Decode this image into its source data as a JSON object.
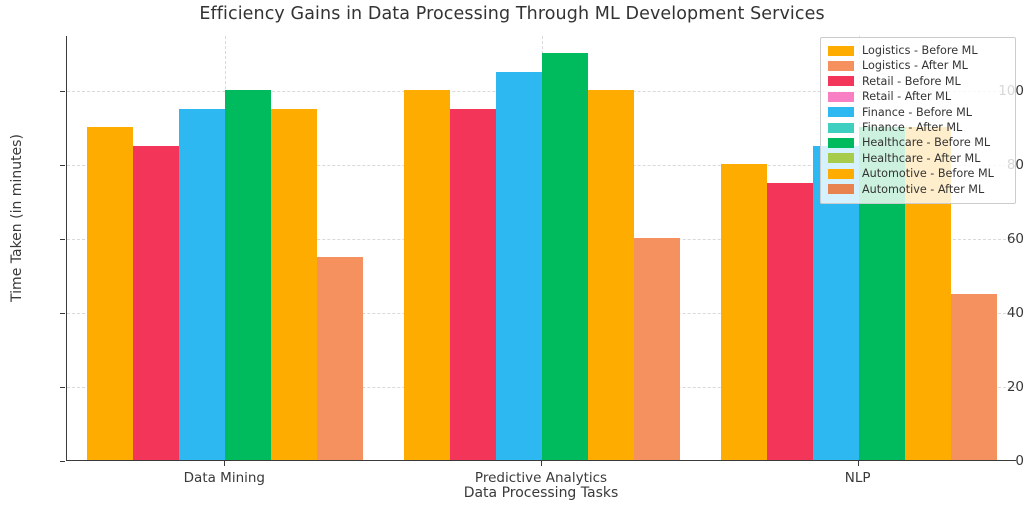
{
  "chart_data": {
    "type": "bar",
    "title": "Efficiency Gains in Data Processing Through ML Development Services",
    "xlabel": "Data Processing Tasks",
    "ylabel": "Time Taken (in minutes)",
    "categories": [
      "Data Mining",
      "Predictive Analytics",
      "NLP"
    ],
    "ylim": [
      0,
      115
    ],
    "yticks": [
      0,
      20,
      40,
      60,
      80,
      100
    ],
    "ytick_labels": [
      "0",
      "20",
      "40",
      "60",
      "80",
      "100"
    ],
    "grid": true,
    "grid_style": "dashed",
    "legend_position": "upper right",
    "bar_style": "grouped",
    "series": [
      {
        "name": "Logistics - Before ML",
        "color": "#FFAC00",
        "values": [
          90,
          100,
          80
        ]
      },
      {
        "name": "Logistics - After ML",
        "color": "#F4915E",
        "values": [
          55,
          60,
          45
        ]
      },
      {
        "name": "Retail - Before ML",
        "color": "#F23558",
        "values": [
          85,
          95,
          75
        ]
      },
      {
        "name": "Retail - After ML",
        "color": "#F97FC4",
        "values": [
          null,
          null,
          null
        ]
      },
      {
        "name": "Finance - Before ML",
        "color": "#2EB8F2",
        "values": [
          95,
          105,
          85
        ]
      },
      {
        "name": "Finance - After ML",
        "color": "#3FCFC0",
        "values": [
          null,
          null,
          null
        ]
      },
      {
        "name": "Healthcare - Before ML",
        "color": "#00BA5E",
        "values": [
          100,
          110,
          90
        ]
      },
      {
        "name": "Healthcare - After ML",
        "color": "#A7CC4B",
        "values": [
          null,
          null,
          null
        ]
      },
      {
        "name": "Automotive - Before ML",
        "color": "#FFAC00",
        "values": [
          95,
          100,
          90
        ]
      },
      {
        "name": "Automotive - After ML",
        "color": "#E8824E",
        "values": [
          null,
          null,
          null
        ]
      }
    ],
    "rendered_bars": [
      {
        "group": 0,
        "slot": 0,
        "series": "Logistics - Before ML",
        "value": 90,
        "color": "#FFAC00"
      },
      {
        "group": 0,
        "slot": 1,
        "series": "Retail - Before ML",
        "value": 85,
        "color": "#F23558"
      },
      {
        "group": 0,
        "slot": 2,
        "series": "Finance - Before ML",
        "value": 95,
        "color": "#2EB8F2"
      },
      {
        "group": 0,
        "slot": 3,
        "series": "Healthcare - Before ML",
        "value": 100,
        "color": "#00BA5E"
      },
      {
        "group": 0,
        "slot": 4,
        "series": "Automotive - Before ML",
        "value": 95,
        "color": "#FFAC00"
      },
      {
        "group": 0,
        "slot": 5,
        "series": "Logistics - After ML",
        "value": 55,
        "color": "#F4915E"
      },
      {
        "group": 1,
        "slot": 0,
        "series": "Logistics - Before ML",
        "value": 100,
        "color": "#FFAC00"
      },
      {
        "group": 1,
        "slot": 1,
        "series": "Retail - Before ML",
        "value": 95,
        "color": "#F23558"
      },
      {
        "group": 1,
        "slot": 2,
        "series": "Finance - Before ML",
        "value": 105,
        "color": "#2EB8F2"
      },
      {
        "group": 1,
        "slot": 3,
        "series": "Healthcare - Before ML",
        "value": 110,
        "color": "#00BA5E"
      },
      {
        "group": 1,
        "slot": 4,
        "series": "Automotive - Before ML",
        "value": 100,
        "color": "#FFAC00"
      },
      {
        "group": 1,
        "slot": 5,
        "series": "Logistics - After ML",
        "value": 60,
        "color": "#F4915E"
      },
      {
        "group": 2,
        "slot": 0,
        "series": "Logistics - Before ML",
        "value": 80,
        "color": "#FFAC00"
      },
      {
        "group": 2,
        "slot": 1,
        "series": "Retail - Before ML",
        "value": 75,
        "color": "#F23558"
      },
      {
        "group": 2,
        "slot": 2,
        "series": "Finance - Before ML",
        "value": 85,
        "color": "#2EB8F2"
      },
      {
        "group": 2,
        "slot": 3,
        "series": "Healthcare - Before ML",
        "value": 90,
        "color": "#00BA5E"
      },
      {
        "group": 2,
        "slot": 4,
        "series": "Automotive - Before ML",
        "value": 90,
        "color": "#FFAC00"
      },
      {
        "group": 2,
        "slot": 5,
        "series": "Logistics - After ML",
        "value": 45,
        "color": "#F4915E"
      }
    ]
  },
  "legend": {
    "items": [
      {
        "label": "Logistics - Before ML",
        "color": "#FFAC00"
      },
      {
        "label": "Logistics - After ML",
        "color": "#F4915E"
      },
      {
        "label": "Retail - Before ML",
        "color": "#F23558"
      },
      {
        "label": "Retail - After ML",
        "color": "#F97FC4"
      },
      {
        "label": "Finance - Before ML",
        "color": "#2EB8F2"
      },
      {
        "label": "Finance - After ML",
        "color": "#3FCFC0"
      },
      {
        "label": "Healthcare - Before ML",
        "color": "#00BA5E"
      },
      {
        "label": "Healthcare - After ML",
        "color": "#A7CC4B"
      },
      {
        "label": "Automotive - Before ML",
        "color": "#FFAC00"
      },
      {
        "label": "Automotive - After ML",
        "color": "#E8824E"
      }
    ]
  },
  "style": {
    "axis_color": "#3a3a3a",
    "grid_color": "#d9d9d9",
    "text_color": "#333333",
    "background": "#ffffff"
  }
}
